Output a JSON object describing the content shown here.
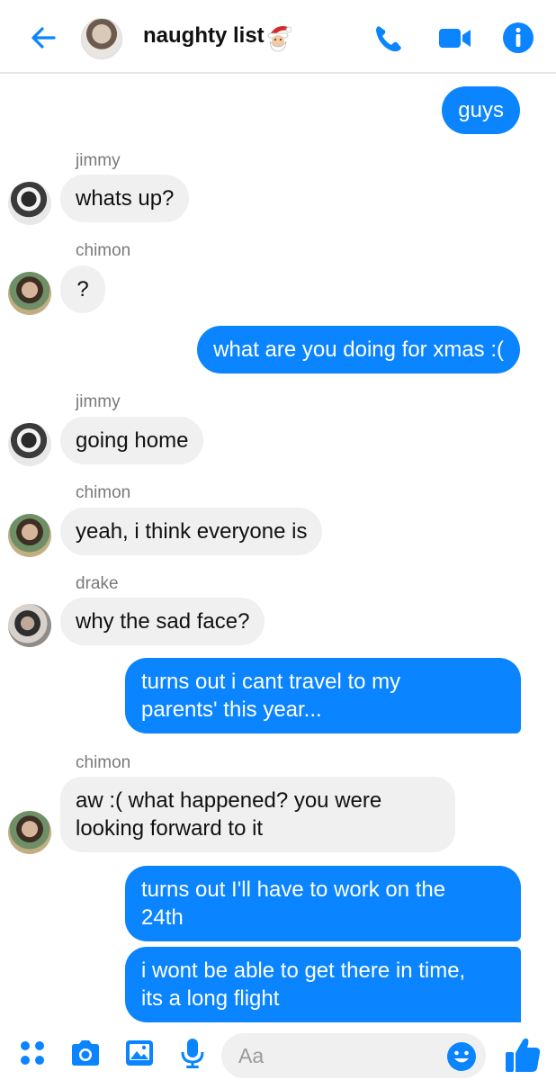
{
  "header": {
    "title": "naughty list",
    "title_emoji": "santa-emoji",
    "icons": [
      "back-arrow-icon",
      "phone-icon",
      "video-camera-icon",
      "info-icon"
    ],
    "accent": "#0a84ff"
  },
  "messages": [
    {
      "sender": "",
      "side": "out",
      "lines": [
        "guys"
      ]
    },
    {
      "sender": "jimmy",
      "side": "in",
      "lines": [
        "whats up?"
      ]
    },
    {
      "sender": "chimon",
      "side": "in",
      "lines": [
        "?"
      ]
    },
    {
      "sender": "",
      "side": "out",
      "lines": [
        "what are you doing for xmas :("
      ]
    },
    {
      "sender": "jimmy",
      "side": "in",
      "lines": [
        "going home"
      ]
    },
    {
      "sender": "chimon",
      "side": "in",
      "lines": [
        "yeah, i think everyone is"
      ]
    },
    {
      "sender": "drake",
      "side": "in",
      "lines": [
        "why the sad face?"
      ]
    },
    {
      "sender": "",
      "side": "out",
      "lines": [
        "turns out i cant travel to my",
        "parents' this year..."
      ]
    },
    {
      "sender": "chimon",
      "side": "in",
      "lines": [
        "aw :( what happened? you were",
        "looking forward to it"
      ]
    },
    {
      "sender": "",
      "side": "out",
      "lines": [
        "turns out I'll have to work on the",
        "24th"
      ]
    },
    {
      "sender": "",
      "side": "out",
      "lines": [
        "i wont be able to get there in time,",
        "its a long flight"
      ]
    }
  ],
  "composer": {
    "placeholder": "Aa",
    "icons": [
      "apps-grid-icon",
      "camera-icon",
      "gallery-icon",
      "microphone-icon",
      "emoji-icon",
      "thumbs-up-icon"
    ]
  },
  "colors": {
    "outgoing_bubble": "#0a84ff",
    "incoming_bubble": "#f0f0f0",
    "sender_name": "#7a7a7a"
  }
}
